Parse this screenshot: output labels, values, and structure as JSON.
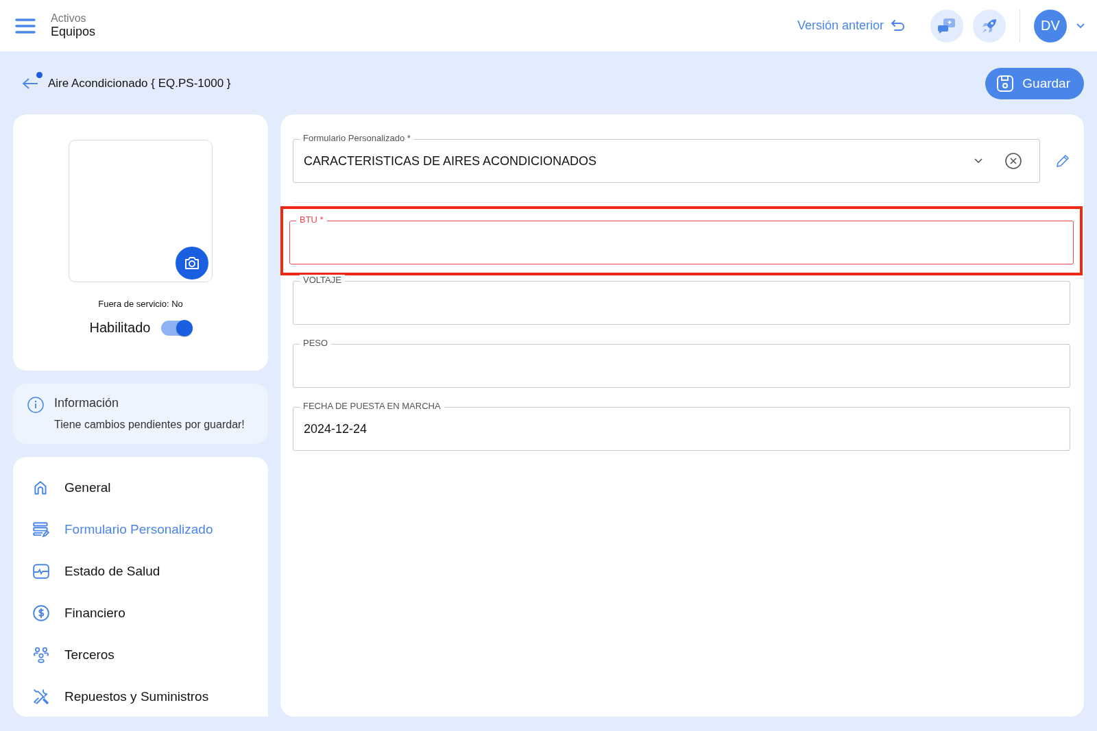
{
  "header": {
    "section": "Activos",
    "title": "Equipos",
    "previous_version": "Versión anterior",
    "avatar": "DV"
  },
  "page": {
    "title": "Aire Acondicionado { EQ.PS-1000 }",
    "unsaved": true,
    "save_button": "Guardar"
  },
  "asset": {
    "out_of_service": "Fuera de servicio: No",
    "enabled_label": "Habilitado",
    "enabled": true
  },
  "info": {
    "title": "Información",
    "message": "Tiene cambios pendientes por guardar!"
  },
  "sidebar": {
    "items": [
      {
        "label": "General",
        "selected": false
      },
      {
        "label": "Formulario Personalizado",
        "selected": true
      },
      {
        "label": "Estado de Salud",
        "selected": false
      },
      {
        "label": "Financiero",
        "selected": false
      },
      {
        "label": "Terceros",
        "selected": false
      },
      {
        "label": "Repuestos y Suministros",
        "selected": false
      }
    ]
  },
  "form": {
    "select": {
      "label": "Formulario Personalizado *",
      "value": "CARACTERISTICAS DE AIRES ACONDICIONADOS"
    },
    "fields": [
      {
        "label": "BTU *",
        "error": true,
        "highlighted": true
      },
      {
        "label": "VOLTAJE",
        "error": false,
        "highlighted": false
      },
      {
        "label": "PESO",
        "error": false,
        "highlighted": false
      },
      {
        "label": "FECHA DE PUESTA EN MARCHA",
        "value": "2024-12-24",
        "error": false,
        "highlighted": false
      }
    ]
  }
}
